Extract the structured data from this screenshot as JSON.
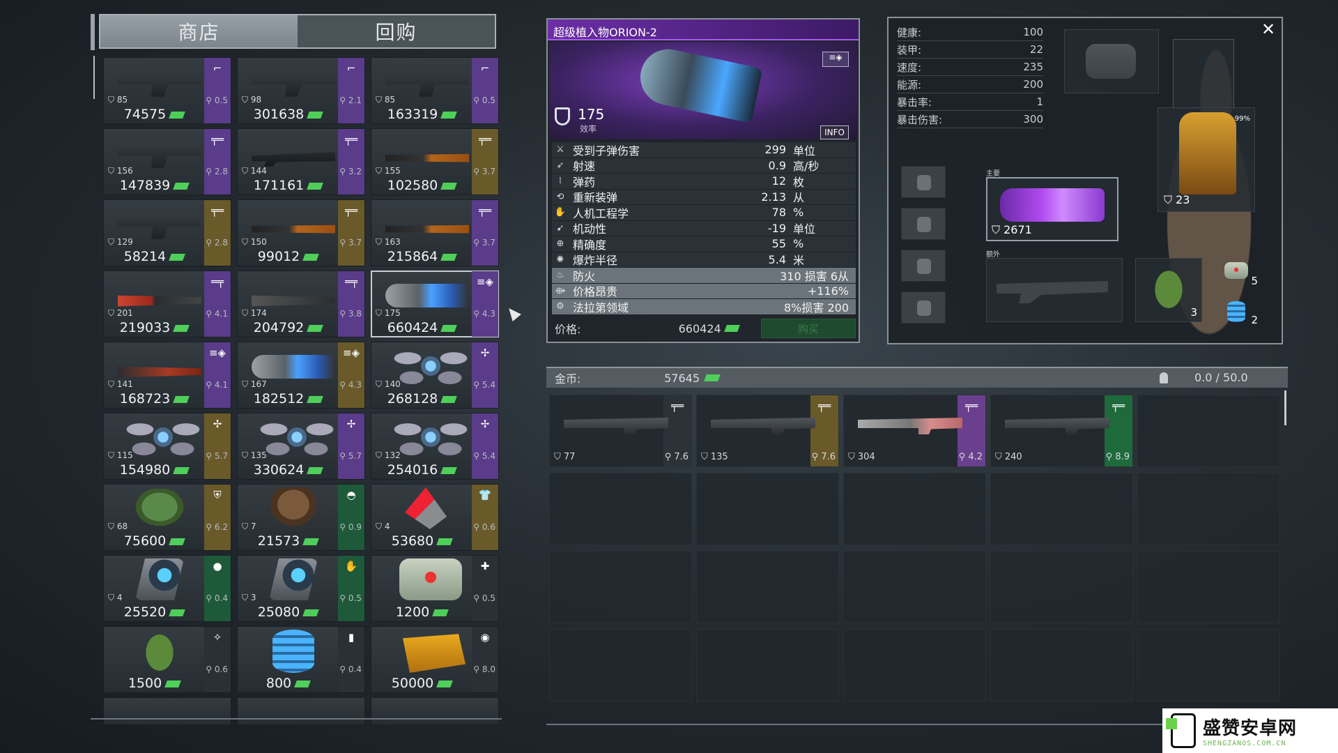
{
  "shop": {
    "tabs": [
      {
        "label": "商店",
        "active": true
      },
      {
        "label": "回购",
        "active": false
      }
    ],
    "items": [
      {
        "art": "gun",
        "band": "purple",
        "type_icon": "pistol-icon",
        "type_glyph": "⌐",
        "level": "85",
        "weight": "0.5",
        "price": "74575"
      },
      {
        "art": "gun",
        "band": "purple",
        "type_icon": "pistol-icon",
        "type_glyph": "⌐",
        "level": "98",
        "weight": "2.1",
        "price": "301638"
      },
      {
        "art": "gun",
        "band": "purple",
        "type_icon": "pistol-icon",
        "type_glyph": "⌐",
        "level": "85",
        "weight": "0.5",
        "price": "163319"
      },
      {
        "art": "gun",
        "band": "purple",
        "type_icon": "rifle-icon",
        "type_glyph": "╤═",
        "level": "156",
        "weight": "2.8",
        "price": "147839"
      },
      {
        "art": "rifle",
        "band": "purple",
        "type_icon": "rifle-icon",
        "type_glyph": "╤═",
        "level": "144",
        "weight": "3.2",
        "price": "171161"
      },
      {
        "art": "rifle-wood",
        "band": "tan",
        "type_icon": "rifle-icon",
        "type_glyph": "╤═",
        "level": "155",
        "weight": "3.7",
        "price": "102580"
      },
      {
        "art": "gun",
        "band": "tan",
        "type_icon": "rifle-icon",
        "type_glyph": "╤═",
        "level": "129",
        "weight": "2.8",
        "price": "58214"
      },
      {
        "art": "rifle-wood",
        "band": "tan",
        "type_icon": "rifle-icon",
        "type_glyph": "╤═",
        "level": "150",
        "weight": "3.7",
        "price": "99012"
      },
      {
        "art": "rifle-wood",
        "band": "purple",
        "type_icon": "rifle-icon",
        "type_glyph": "╤═",
        "level": "163",
        "weight": "3.7",
        "price": "215864"
      },
      {
        "art": "shotgun-red",
        "band": "purple",
        "type_icon": "shotgun-icon",
        "type_glyph": "═╤",
        "level": "201",
        "weight": "4.1",
        "price": "219033"
      },
      {
        "art": "shotgun",
        "band": "purple",
        "type_icon": "shotgun-icon",
        "type_glyph": "═╤",
        "level": "174",
        "weight": "3.8",
        "price": "204792"
      },
      {
        "art": "plasma",
        "band": "purple",
        "type_icon": "heavy-weapon-icon",
        "type_glyph": "≡◈",
        "level": "175",
        "weight": "4.3",
        "price": "660424",
        "selected": true
      },
      {
        "art": "rifle-red",
        "band": "purple",
        "type_icon": "heavy-weapon-icon",
        "type_glyph": "≡◈",
        "level": "141",
        "weight": "4.1",
        "price": "168723"
      },
      {
        "art": "plasma",
        "band": "tan",
        "type_icon": "heavy-weapon-icon",
        "type_glyph": "≡◈",
        "level": "167",
        "weight": "4.3",
        "price": "182512"
      },
      {
        "art": "drone",
        "band": "purple",
        "type_icon": "drone-icon",
        "type_glyph": "✢",
        "level": "140",
        "weight": "5.4",
        "price": "268128"
      },
      {
        "art": "drone",
        "band": "tan",
        "type_icon": "drone-icon",
        "type_glyph": "✢",
        "level": "115",
        "weight": "5.7",
        "price": "154980"
      },
      {
        "art": "drone",
        "band": "purple",
        "type_icon": "drone-icon",
        "type_glyph": "✢",
        "level": "135",
        "weight": "5.7",
        "price": "330624"
      },
      {
        "art": "drone",
        "band": "purple",
        "type_icon": "drone-icon",
        "type_glyph": "✢",
        "level": "132",
        "weight": "5.4",
        "price": "254016"
      },
      {
        "art": "helmet-green",
        "band": "tan",
        "type_icon": "armor-icon",
        "type_glyph": "⛨",
        "level": "68",
        "weight": "6.2",
        "price": "75600"
      },
      {
        "art": "hat",
        "band": "green",
        "type_icon": "helmet-icon",
        "type_glyph": "◓",
        "level": "7",
        "weight": "0.9",
        "price": "21573"
      },
      {
        "art": "cone",
        "band": "tan",
        "type_icon": "shirt-icon",
        "type_glyph": "👕",
        "level": "4",
        "weight": "0.6",
        "price": "53680"
      },
      {
        "art": "canister",
        "band": "green",
        "type_icon": "head-implant-icon",
        "type_glyph": "●",
        "level": "4",
        "weight": "0.4",
        "price": "25520"
      },
      {
        "art": "canister",
        "band": "green",
        "type_icon": "hand-implant-icon",
        "type_glyph": "✋",
        "level": "3",
        "weight": "0.5",
        "price": "25080"
      },
      {
        "art": "medkit",
        "band": "dark",
        "type_icon": "medkit-icon",
        "type_glyph": "✚",
        "level": "",
        "weight": "0.5",
        "price": "1200"
      },
      {
        "art": "grenade",
        "band": "dark",
        "type_icon": "grenade-icon",
        "type_glyph": "✧",
        "level": "",
        "weight": "0.6",
        "price": "1500"
      },
      {
        "art": "coil",
        "band": "dark",
        "type_icon": "battery-icon",
        "type_glyph": "▮",
        "level": "",
        "weight": "0.4",
        "price": "800"
      },
      {
        "art": "ammo",
        "band": "dark",
        "type_icon": "ammo-icon",
        "type_glyph": "◉",
        "level": "",
        "weight": "8.0",
        "price": "50000"
      },
      {
        "art": "",
        "band": "dark",
        "type_icon": "",
        "type_glyph": "",
        "level": "",
        "weight": "",
        "price": ""
      },
      {
        "art": "",
        "band": "dark",
        "type_icon": "",
        "type_glyph": "",
        "level": "",
        "weight": "",
        "price": ""
      },
      {
        "art": "",
        "band": "dark",
        "type_icon": "",
        "type_glyph": "",
        "level": "",
        "weight": "",
        "price": ""
      }
    ]
  },
  "detail": {
    "title": "超级植入物ORION-2",
    "efficiency_value": "175",
    "efficiency_label": "效率",
    "info_label": "INFO",
    "stats": [
      {
        "icon": "damage-icon",
        "glyph": "⚔",
        "name": "受到子弹伤害",
        "value": "299",
        "unit": "单位"
      },
      {
        "icon": "fire-rate-icon",
        "glyph": "➶",
        "name": "射速",
        "value": "0.9",
        "unit": "高/秒"
      },
      {
        "icon": "ammo-icon",
        "glyph": "⁞",
        "name": "弹药",
        "value": "12",
        "unit": "枚"
      },
      {
        "icon": "reload-icon",
        "glyph": "⟲",
        "name": "重新装弹",
        "value": "2.13",
        "unit": "从"
      },
      {
        "icon": "ergonomics-icon",
        "glyph": "✋",
        "name": "人机工程学",
        "value": "78",
        "unit": "%"
      },
      {
        "icon": "mobility-icon",
        "glyph": "➹",
        "name": "机动性",
        "value": "-19",
        "unit": "单位"
      },
      {
        "icon": "accuracy-icon",
        "glyph": "⊕",
        "name": "精确度",
        "value": "55",
        "unit": "%"
      },
      {
        "icon": "blast-radius-icon",
        "glyph": "✺",
        "name": "爆炸半径",
        "value": "5.4",
        "unit": "米"
      },
      {
        "icon": "fire-icon",
        "glyph": "♨",
        "name": "防火",
        "full": "310 损害 6从",
        "highlight": true
      },
      {
        "icon": "price-icon",
        "glyph": "⟴",
        "name": "价格昂贵",
        "full": "+116%",
        "highlight": true
      },
      {
        "icon": "faraday-icon",
        "glyph": "⚙",
        "name": "法拉第领域",
        "full": "8%损害 200",
        "highlight": true
      }
    ],
    "price_label": "价格:",
    "price_value": "660424",
    "buy_label": "购买"
  },
  "character": {
    "stats": [
      {
        "name": "健康:",
        "value": "100"
      },
      {
        "name": "装甲:",
        "value": "22"
      },
      {
        "name": "速度:",
        "value": "235"
      },
      {
        "name": "能源:",
        "value": "200"
      },
      {
        "name": "暴击率:",
        "value": "1"
      },
      {
        "name": "暴击伤害:",
        "value": "300"
      }
    ],
    "main_label": "主要",
    "main_value": "2671",
    "extra_label": "额外",
    "armor_value": "23",
    "armor_pct": "99%",
    "grenade_count": "3",
    "medkit_count": "5",
    "battery_count": "2"
  },
  "inventory": {
    "gold_label": "金币:",
    "gold_value": "57645",
    "weight": "0.0 / 50.0",
    "slots": [
      {
        "band": "#2c3338",
        "type_icon": "rifle-icon",
        "type_glyph": "╤═",
        "level": "77",
        "weight": "7.6",
        "art": "dark"
      },
      {
        "band": "#6a5a2a",
        "type_icon": "rifle-icon",
        "type_glyph": "╤═",
        "level": "135",
        "weight": "7.6",
        "art": "dark"
      },
      {
        "band": "#6a3f8e",
        "type_icon": "rifle-icon",
        "type_glyph": "╤═",
        "level": "304",
        "weight": "4.2",
        "art": "pink"
      },
      {
        "band": "#1e6a3a",
        "type_icon": "rifle-icon",
        "type_glyph": "╤═",
        "level": "240",
        "weight": "8.9",
        "art": "dark"
      }
    ]
  },
  "watermark": {
    "title": "盛赞安卓网",
    "url": "SHENGZANOS.COM.CN"
  }
}
